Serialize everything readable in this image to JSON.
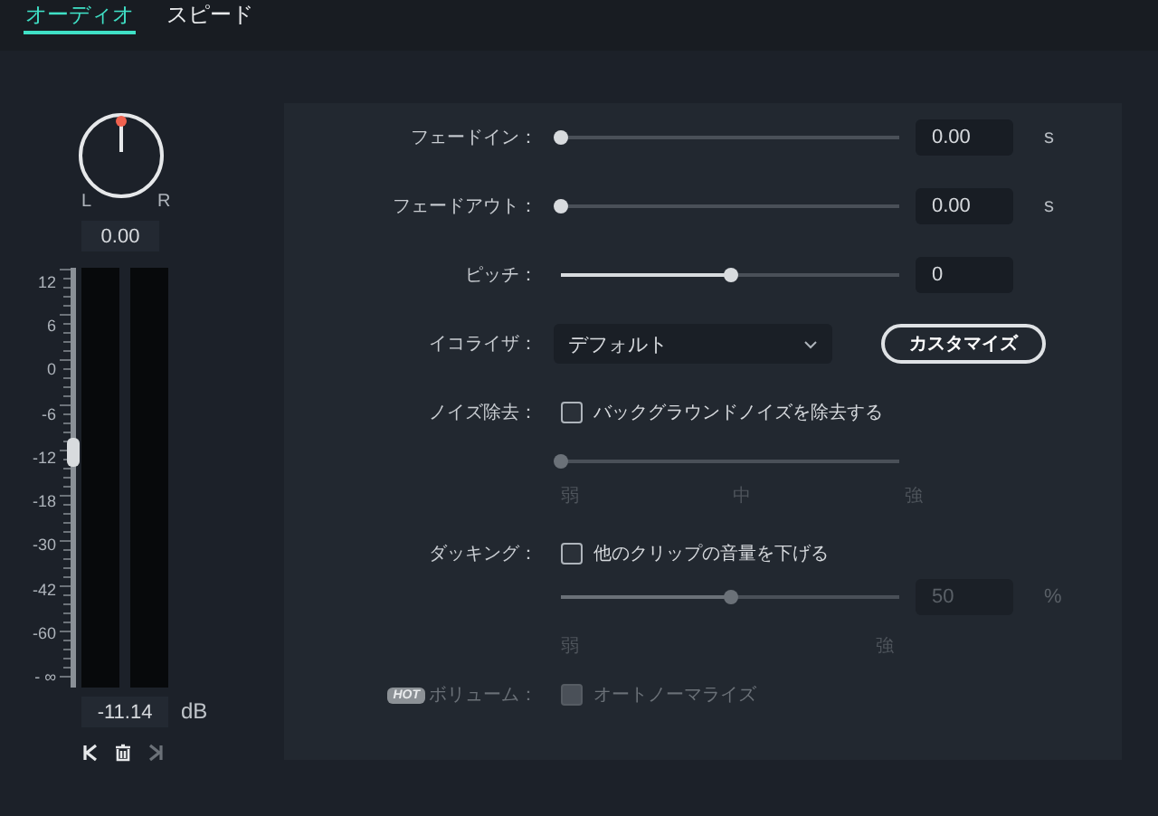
{
  "tabs": [
    {
      "label": "オーディオ",
      "selected": true
    },
    {
      "label": "スピード",
      "selected": false
    }
  ],
  "pan": {
    "left_label": "L",
    "right_label": "R",
    "value": "0.00"
  },
  "volume": {
    "scale": [
      "12",
      "6",
      "0",
      "-6",
      "-12",
      "-18",
      "-30",
      "-42",
      "-60",
      "- ∞"
    ],
    "level": 0.56,
    "value": "-11.14",
    "unit": "dB"
  },
  "settings": [
    {
      "kind": "slider",
      "label": "フェードイン：",
      "level": 0,
      "value": "0.00",
      "unit": "s"
    },
    {
      "kind": "slider",
      "label": "フェードアウト：",
      "level": 0,
      "value": "0.00",
      "unit": "s"
    },
    {
      "kind": "slider",
      "label": "ピッチ：",
      "level": 0.5,
      "value": "0"
    },
    {
      "kind": "dropdown",
      "label": "イコライザ：",
      "value": "デフォルト",
      "button": "カスタマイズ"
    },
    {
      "kind": "checkbox",
      "label": "ノイズ除去：",
      "text": "バックグラウンドノイズを除去する",
      "checked": false,
      "disabled": false
    },
    {
      "kind": "scale",
      "level": 0,
      "ticks": [
        "弱",
        "中",
        "強"
      ],
      "disabled": true
    },
    {
      "kind": "checkbox",
      "label": "ダッキング：",
      "text": "他のクリップの音量を下げる",
      "checked": false,
      "disabled": false
    },
    {
      "kind": "scale",
      "level": 0.5,
      "value": "50",
      "unit": "%",
      "ticks": [
        "弱",
        "強"
      ],
      "disabled": true
    },
    {
      "kind": "checkbox",
      "badge": "HOT",
      "label": "ボリューム：",
      "text": "オートノーマライズ",
      "checked": false,
      "disabled": true
    }
  ]
}
